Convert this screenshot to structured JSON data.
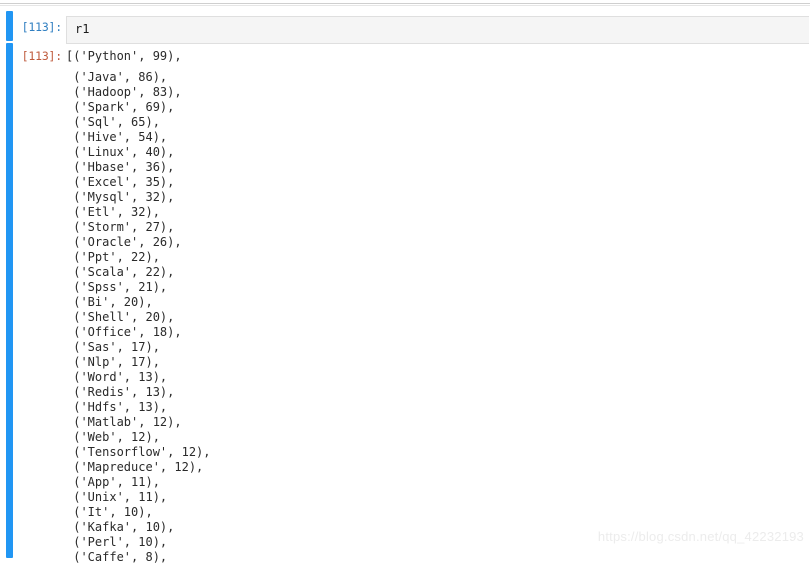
{
  "theme": {
    "selected_cell_bar_color": "#2196f3",
    "input_prompt_color": "#307fc1",
    "output_prompt_color": "#bf5b3d",
    "input_background": "#f5f5f5",
    "page_background": "#ffffff",
    "watermark_color": "#ececec"
  },
  "cells": {
    "input": {
      "prompt": "[113]:",
      "code": "r1",
      "placeholder": ""
    },
    "output": {
      "prompt": "[113]:",
      "open_bracket": "[",
      "entries": [
        {
          "name": "Python",
          "count": 99
        },
        {
          "name": "Java",
          "count": 86
        },
        {
          "name": "Hadoop",
          "count": 83
        },
        {
          "name": "Spark",
          "count": 69
        },
        {
          "name": "Sql",
          "count": 65
        },
        {
          "name": "Hive",
          "count": 54
        },
        {
          "name": "Linux",
          "count": 40
        },
        {
          "name": "Hbase",
          "count": 36
        },
        {
          "name": "Excel",
          "count": 35
        },
        {
          "name": "Mysql",
          "count": 32
        },
        {
          "name": "Etl",
          "count": 32
        },
        {
          "name": "Storm",
          "count": 27
        },
        {
          "name": "Oracle",
          "count": 26
        },
        {
          "name": "Ppt",
          "count": 22
        },
        {
          "name": "Scala",
          "count": 22
        },
        {
          "name": "Spss",
          "count": 21
        },
        {
          "name": "Bi",
          "count": 20
        },
        {
          "name": "Shell",
          "count": 20
        },
        {
          "name": "Office",
          "count": 18
        },
        {
          "name": "Sas",
          "count": 17
        },
        {
          "name": "Nlp",
          "count": 17
        },
        {
          "name": "Word",
          "count": 13
        },
        {
          "name": "Redis",
          "count": 13
        },
        {
          "name": "Hdfs",
          "count": 13
        },
        {
          "name": "Matlab",
          "count": 12
        },
        {
          "name": "Web",
          "count": 12
        },
        {
          "name": "Tensorflow",
          "count": 12
        },
        {
          "name": "Mapreduce",
          "count": 12
        },
        {
          "name": "App",
          "count": 11
        },
        {
          "name": "Unix",
          "count": 11
        },
        {
          "name": "It",
          "count": 10
        },
        {
          "name": "Kafka",
          "count": 10
        },
        {
          "name": "Perl",
          "count": 10
        },
        {
          "name": "Caffe",
          "count": 8
        }
      ]
    }
  },
  "watermark": {
    "text": "https://blog.csdn.net/qq_42232193"
  }
}
